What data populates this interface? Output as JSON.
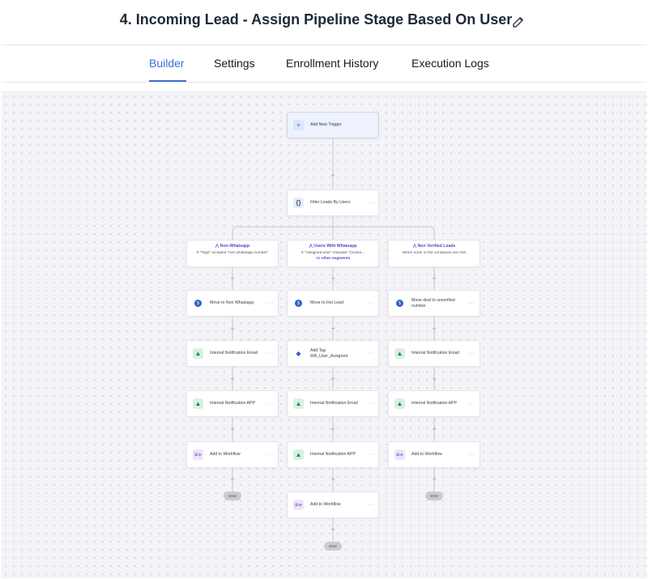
{
  "header": {
    "title": "4. Incoming Lead - Assign Pipeline Stage Based On User",
    "edit_icon": "pencil-icon"
  },
  "tabs": [
    {
      "label": "Builder",
      "active": true
    },
    {
      "label": "Settings",
      "active": false
    },
    {
      "label": "Enrollment History",
      "active": false
    },
    {
      "label": "Execution Logs",
      "active": false
    }
  ],
  "colors": {
    "accent": "#3b6fd6",
    "branch": "#6b3fc8",
    "notify": "#0f8a4f"
  },
  "workflow": {
    "trigger": {
      "label": "Add New Trigger",
      "icon": "plus-icon"
    },
    "filter": {
      "label": "Filter Leads By Users",
      "icon": "braces-icon",
      "more": "···"
    },
    "branches": [
      {
        "title": "Non-Whatsapp",
        "condition": "If \"Tags\" includes \"non whatsapp number\"",
        "extra": ""
      },
      {
        "title": "Users With Whatsapp",
        "condition": "If \"Assigned user\" includes \"Cecilia...",
        "extra": "+1 other segments"
      },
      {
        "title": "Non Verified Leads",
        "condition": "When none of the conditions are met",
        "extra": ""
      }
    ],
    "left_actions": [
      {
        "label": "Move to Non Whatsapp",
        "icon": "pipeline-icon"
      },
      {
        "label": "Internal Notification Email",
        "icon": "bell-icon"
      },
      {
        "label": "Internal Notification APP",
        "icon": "bell-icon"
      },
      {
        "label": "Add to Workflow",
        "icon": "workflow-add-icon"
      }
    ],
    "middle_actions": [
      {
        "label": "Move to Hot Lead",
        "icon": "pipeline-icon"
      },
      {
        "label": "Add Tag",
        "label2": "WA_User_Assigned",
        "icon": "tag-icon"
      },
      {
        "label": "Internal Notification Email",
        "icon": "bell-icon"
      },
      {
        "label": "Internal Notification APP",
        "icon": "bell-icon"
      },
      {
        "label": "Add to Workflow",
        "icon": "workflow-add-icon"
      }
    ],
    "right_actions": [
      {
        "label": "Move deal to unverified",
        "label2": "number",
        "icon": "pipeline-icon"
      },
      {
        "label": "Internal Notification Email",
        "icon": "bell-icon"
      },
      {
        "label": "Internal Notification APP",
        "icon": "bell-icon"
      },
      {
        "label": "Add to Workflow",
        "icon": "workflow-add-icon"
      }
    ],
    "end_label": "END",
    "more": "···"
  }
}
